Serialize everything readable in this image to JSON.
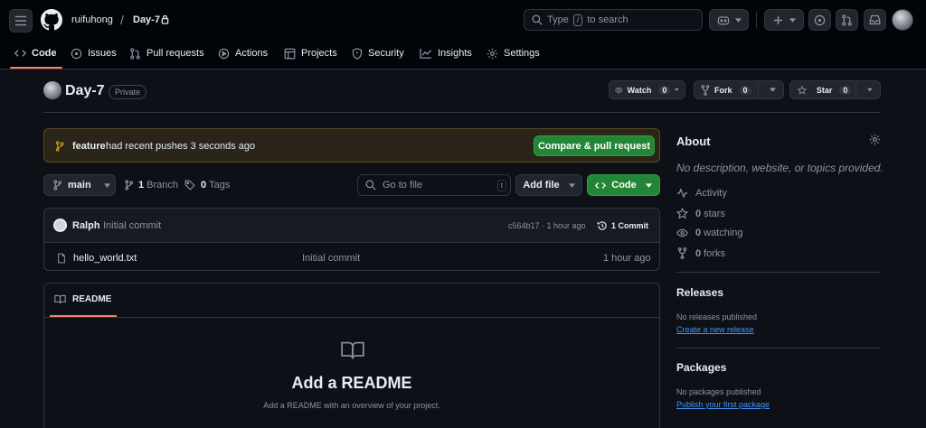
{
  "header": {
    "owner": "ruifuhong",
    "slash": "/",
    "repo": "Day-7",
    "search_prefix": "Type",
    "search_key": "/",
    "search_suffix": "to search"
  },
  "tabs": [
    {
      "label": "Code",
      "icon": "code-icon"
    },
    {
      "label": "Issues",
      "icon": "issue-icon"
    },
    {
      "label": "Pull requests",
      "icon": "pull-request-icon"
    },
    {
      "label": "Actions",
      "icon": "play-icon"
    },
    {
      "label": "Projects",
      "icon": "table-icon"
    },
    {
      "label": "Security",
      "icon": "shield-icon"
    },
    {
      "label": "Insights",
      "icon": "graph-icon"
    },
    {
      "label": "Settings",
      "icon": "gear-icon"
    }
  ],
  "repo_head": {
    "name": "Day-7",
    "visibility": "Private",
    "watch_label": "Watch",
    "watch_count": "0",
    "fork_label": "Fork",
    "fork_count": "0",
    "star_label": "Star",
    "star_count": "0"
  },
  "banner": {
    "branch": "feature",
    "message": "had recent pushes 3 seconds ago",
    "button": "Compare & pull request"
  },
  "toolbar": {
    "branch": "main",
    "branch_count": "1",
    "branch_word": "Branch",
    "tag_count": "0",
    "tag_word": "Tags",
    "goto_placeholder": "Go to file",
    "goto_key": "t",
    "add_file": "Add file",
    "code_button": "Code"
  },
  "commit": {
    "author": "Ralph",
    "message": "Initial commit",
    "sha_time": "c564b17 · 1 hour ago",
    "count": "1 Commit"
  },
  "files": [
    {
      "name": "hello_world.txt",
      "message": "Initial commit",
      "time": "1 hour ago"
    }
  ],
  "readme": {
    "tab": "README",
    "title": "Add a README",
    "subtitle": "Add a README with an overview of your project."
  },
  "about": {
    "title": "About",
    "description": "No description, website, or topics provided.",
    "activity": "Activity",
    "stars_count": "0",
    "stars_word": "stars",
    "watching_count": "0",
    "watching_word": "watching",
    "forks_count": "0",
    "forks_word": "forks"
  },
  "releases": {
    "title": "Releases",
    "empty": "No releases published",
    "link": "Create a new release"
  },
  "packages": {
    "title": "Packages",
    "empty": "No packages published",
    "link": "Publish your first package"
  },
  "colors": {
    "accent_green": "#238636",
    "tab_underline": "#f78166",
    "link_blue": "#4493f8",
    "banner_bg": "#2b2418"
  }
}
